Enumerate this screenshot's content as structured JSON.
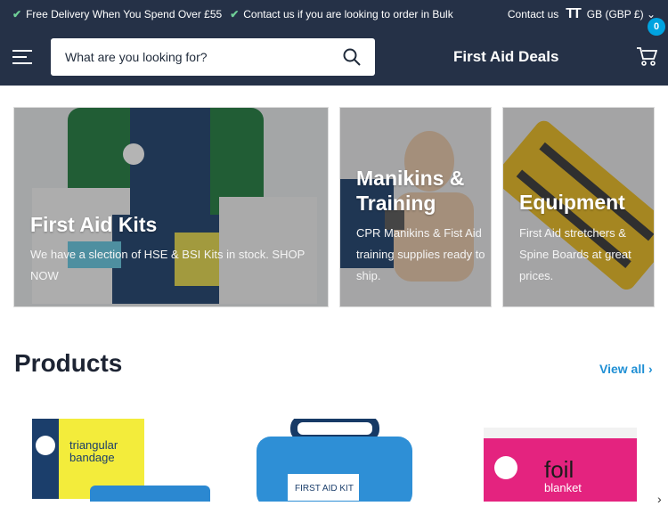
{
  "topbar": {
    "msg1": "Free Delivery When You Spend Over £55",
    "msg2": "Contact us if you are looking to order in Bulk",
    "contact": "Contact us",
    "currency": "GB (GBP £)"
  },
  "header": {
    "search_placeholder": "What are you looking for?",
    "brand": "First Aid Deals",
    "cart_count": "0"
  },
  "collections": [
    {
      "title": "First Aid Kits",
      "desc": "We have a slection of HSE & BSI Kits in stock. SHOP NOW"
    },
    {
      "title": "Manikins & Training",
      "desc": "CPR Manikins & Fist Aid training supplies ready to ship."
    },
    {
      "title": "Equipment",
      "desc": "First Aid stretchers & Spine Boards at great prices."
    }
  ],
  "products": {
    "heading": "Products",
    "view_all": "View all",
    "items": [
      {
        "label1": "triangular",
        "label2": "bandage"
      },
      {
        "label1": "FIRST AID KIT"
      },
      {
        "label1": "foil",
        "label2": "blanket"
      }
    ]
  },
  "colors": {
    "header_bg": "#253147",
    "accent": "#1f8fd4",
    "badge": "#00a3e0"
  }
}
